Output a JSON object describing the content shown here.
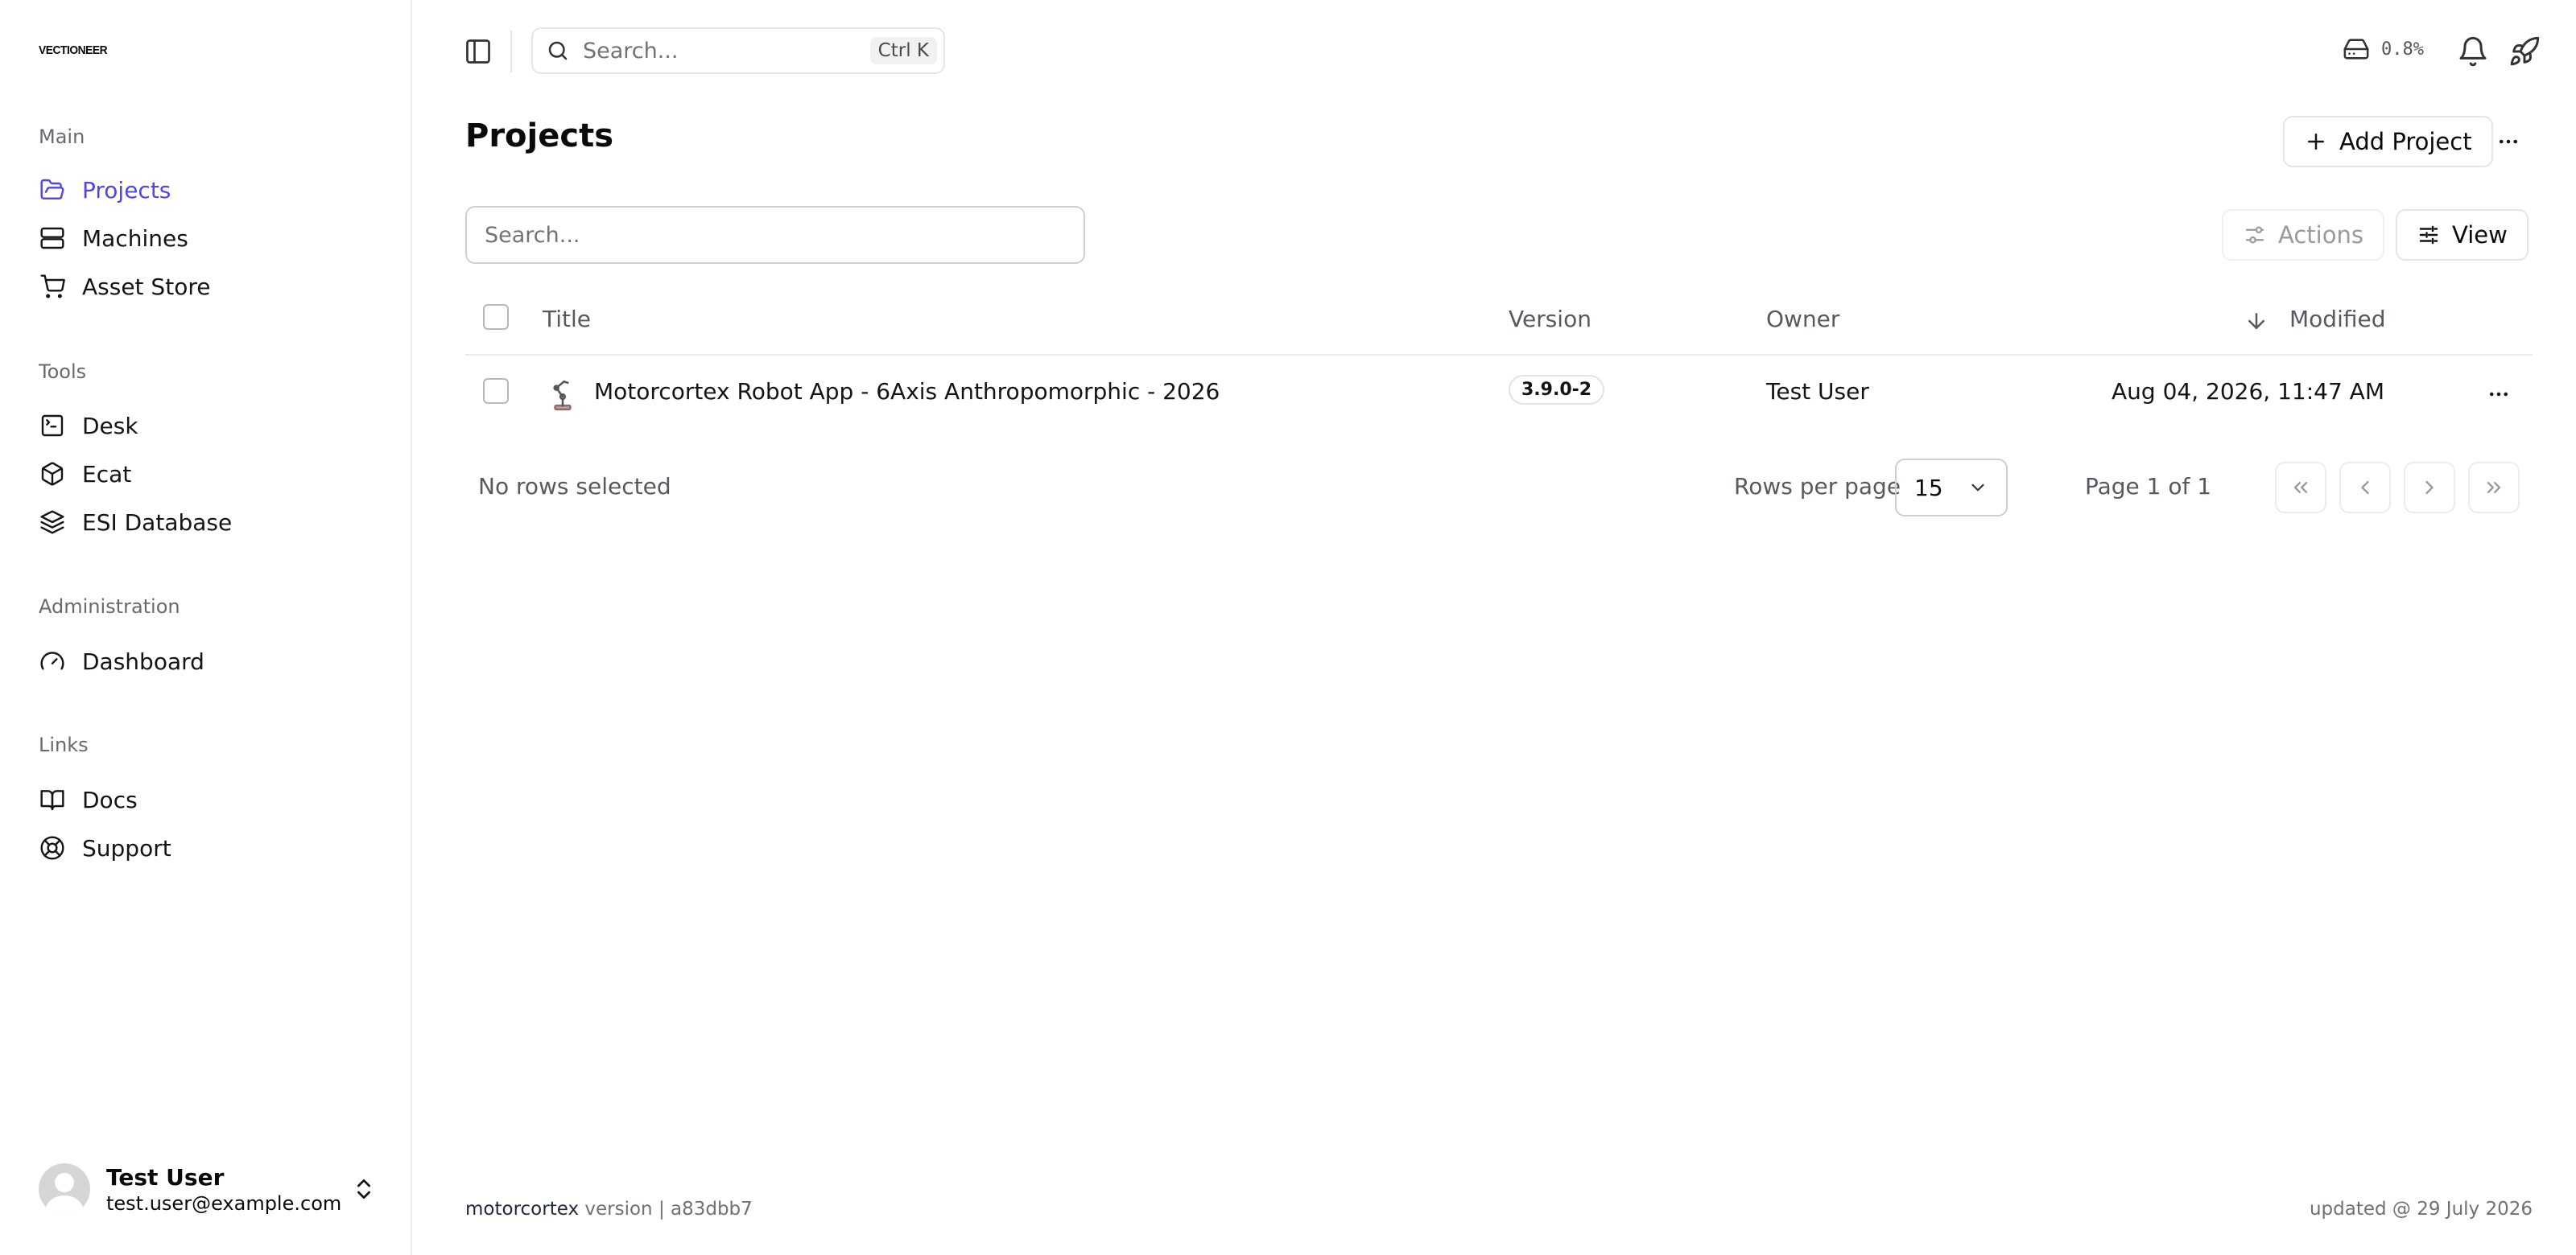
{
  "sidebar": {
    "logo": "VECTIONEER",
    "groups": [
      {
        "label": "Main",
        "items": [
          {
            "label": "Projects",
            "icon": "folder-open-icon",
            "active": true
          },
          {
            "label": "Machines",
            "icon": "server-icon"
          },
          {
            "label": "Asset Store",
            "icon": "cart-icon"
          }
        ]
      },
      {
        "label": "Tools",
        "items": [
          {
            "label": "Desk",
            "icon": "terminal-icon"
          },
          {
            "label": "Ecat",
            "icon": "box-icon"
          },
          {
            "label": "ESI Database",
            "icon": "layers-icon"
          }
        ]
      },
      {
        "label": "Administration",
        "items": [
          {
            "label": "Dashboard",
            "icon": "gauge-icon"
          }
        ]
      },
      {
        "label": "Links",
        "items": [
          {
            "label": "Docs",
            "icon": "book-icon"
          },
          {
            "label": "Support",
            "icon": "lifebuoy-icon"
          }
        ]
      }
    ],
    "user": {
      "name": "Test User",
      "email": "test.user@example.com"
    }
  },
  "topbar": {
    "search_placeholder": "Search...",
    "shortcut": "Ctrl K",
    "disk_usage": "0.8%"
  },
  "page": {
    "title": "Projects",
    "add_button": "Add Project",
    "table_search_placeholder": "Search...",
    "actions_button": "Actions",
    "view_button": "View"
  },
  "table": {
    "columns": {
      "title": "Title",
      "version": "Version",
      "owner": "Owner",
      "modified": "Modified"
    },
    "rows": [
      {
        "title": "Motorcortex Robot App - 6Axis Anthropomorphic - 2026",
        "version": "3.9.0-2",
        "owner": "Test User",
        "modified": "Aug 04, 2026, 11:47 AM"
      }
    ],
    "selection_status": "No rows selected",
    "rows_per_page_label": "Rows per page",
    "rows_per_page": "15",
    "page_info": "Page 1 of 1"
  },
  "footer": {
    "product": "motorcortex",
    "version_text": "version | a83dbb7",
    "updated": "updated @ 29 July 2026"
  },
  "colors": {
    "accent": "#4f46e5",
    "border": "#e5e5e5",
    "muted": "#737373"
  }
}
